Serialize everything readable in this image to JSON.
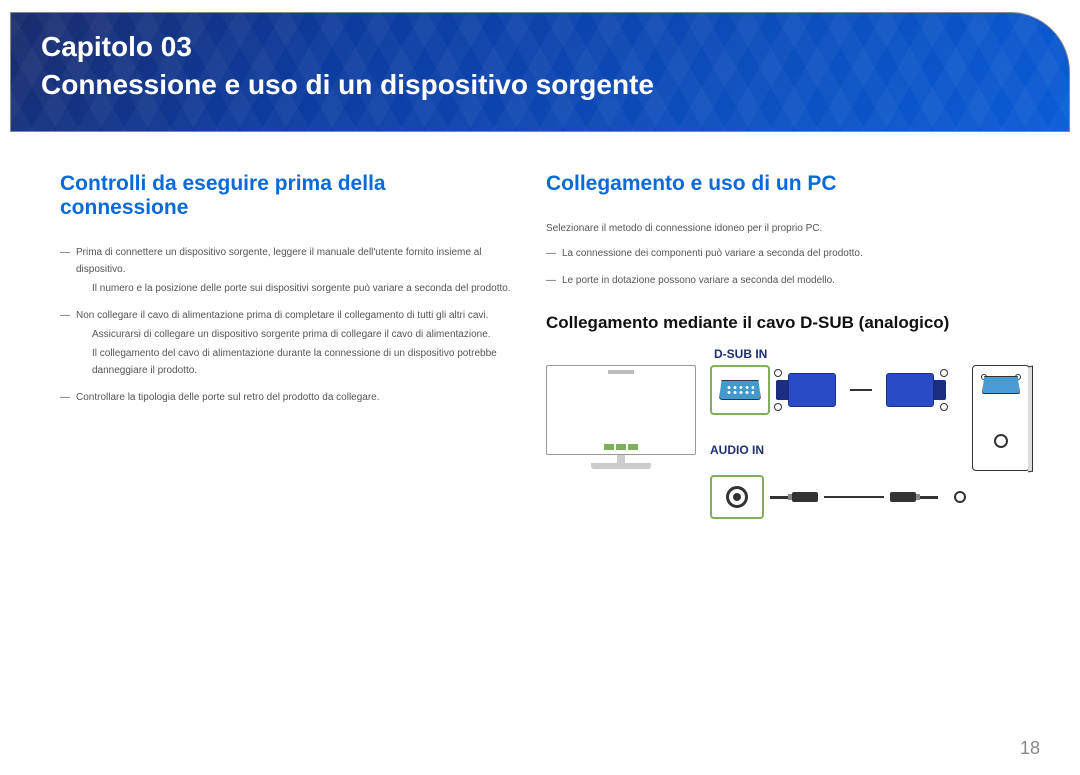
{
  "header": {
    "chapter_label": "Capitolo 03",
    "chapter_title": "Connessione e uso di un dispositivo sorgente"
  },
  "left_column": {
    "heading": "Controlli da eseguire prima della connessione",
    "items": [
      {
        "main": "Prima di connettere un dispositivo sorgente, leggere il manuale dell'utente fornito insieme al dispositivo.",
        "sub": "Il numero e la posizione delle porte sui dispositivi sorgente può variare a seconda del prodotto."
      },
      {
        "main": "Non collegare il cavo di alimentazione prima di completare il collegamento di tutti gli altri cavi.",
        "sub": "Assicurarsi di collegare un dispositivo sorgente prima di collegare il cavo di alimentazione.",
        "sub2": "Il collegamento del cavo di alimentazione durante la connessione di un dispositivo potrebbe danneggiare il prodotto."
      },
      {
        "main": "Controllare la tipologia delle porte sul retro del prodotto da collegare."
      }
    ]
  },
  "right_column": {
    "heading": "Collegamento e uso di un PC",
    "intro": "Selezionare il metodo di connessione idoneo per il proprio PC.",
    "notes": [
      "La connessione dei componenti può variare a seconda del prodotto.",
      "Le porte in dotazione possono variare a seconda del modello."
    ],
    "sub_heading": "Collegamento mediante il cavo D-SUB (analogico)",
    "labels": {
      "dsub": "D-SUB IN",
      "audio": "AUDIO IN"
    }
  },
  "page_number": "18"
}
